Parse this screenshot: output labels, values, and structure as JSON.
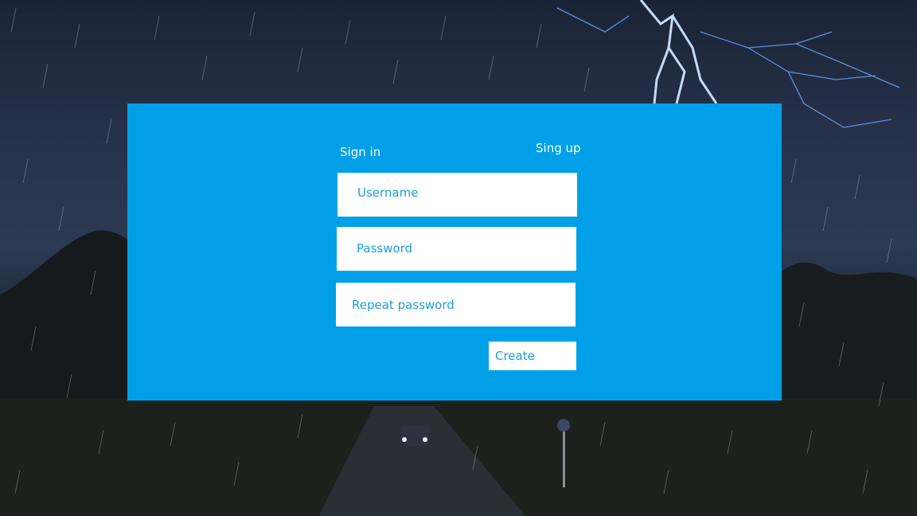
{
  "tabs": {
    "sign_in": "Sign in",
    "sign_up": "Sing up"
  },
  "form": {
    "username_placeholder": "Username",
    "username_value": "",
    "password_placeholder": "Password",
    "password_value": "",
    "repeat_password_placeholder": "Repeat password",
    "repeat_password_value": "",
    "create_label": "Create"
  },
  "colors": {
    "panel": "#00a0e8",
    "field_background": "#ffffff",
    "field_text": "#1a9fd8",
    "tab_text": "#ffffff"
  }
}
